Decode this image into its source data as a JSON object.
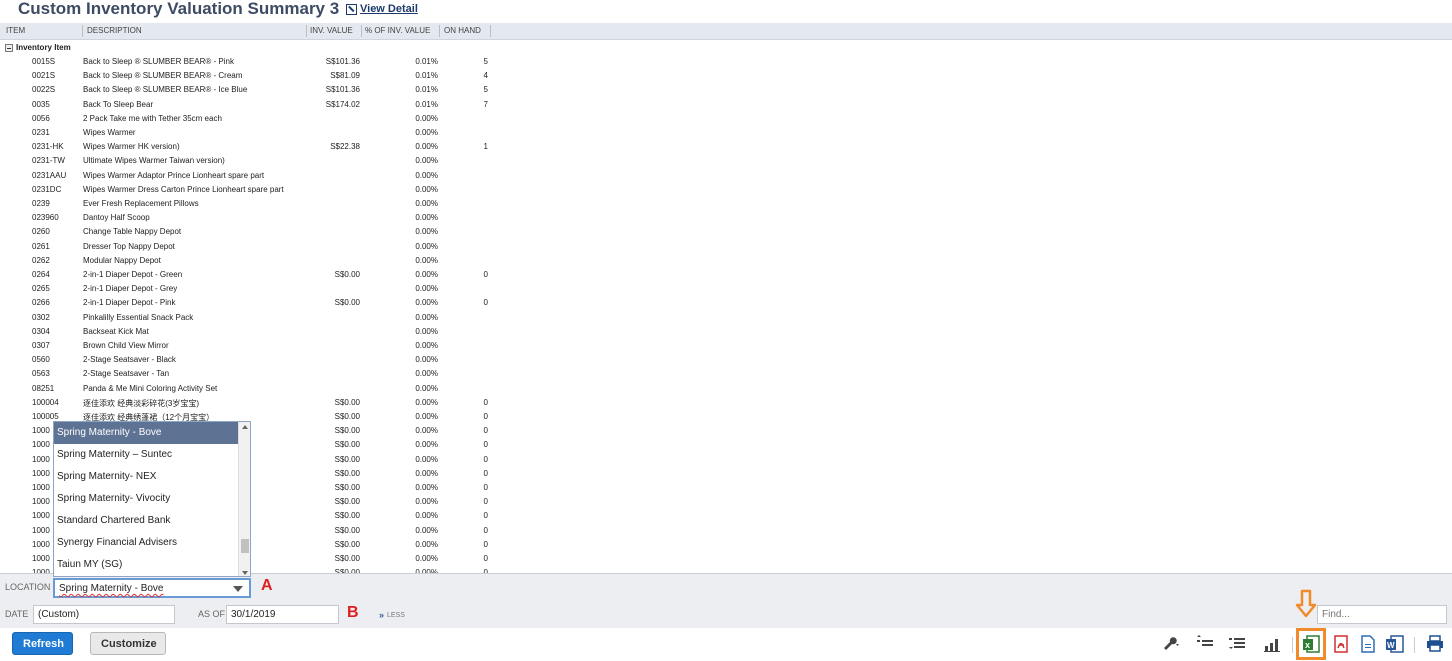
{
  "header": {
    "title": "Custom Inventory Valuation Summary 3",
    "view_detail": "View Detail"
  },
  "columns": {
    "item": "ITEM",
    "description": "DESCRIPTION",
    "inv_value": "INV. VALUE",
    "pct": "% OF INV. VALUE",
    "on_hand": "ON HAND"
  },
  "group": {
    "label": "Inventory Item"
  },
  "rows": [
    {
      "item": "0015S",
      "desc": "Back to Sleep ® SLUMBER BEAR® - Pink",
      "val": "S$101.36",
      "pct": "0.01%",
      "hand": "5"
    },
    {
      "item": "0021S",
      "desc": "Back to Sleep ® SLUMBER BEAR® - Cream",
      "val": "S$81.09",
      "pct": "0.01%",
      "hand": "4"
    },
    {
      "item": "0022S",
      "desc": "Back to Sleep ® SLUMBER BEAR® - Ice Blue",
      "val": "S$101.36",
      "pct": "0.01%",
      "hand": "5"
    },
    {
      "item": "0035",
      "desc": "Back To Sleep Bear",
      "val": "S$174.02",
      "pct": "0.01%",
      "hand": "7"
    },
    {
      "item": "0056",
      "desc": "2 Pack Take me with Tether 35cm each",
      "val": "",
      "pct": "0.00%",
      "hand": ""
    },
    {
      "item": "0231",
      "desc": "Wipes Warmer",
      "val": "",
      "pct": "0.00%",
      "hand": ""
    },
    {
      "item": "0231-HK",
      "desc": "Wipes Warmer HK version)",
      "val": "S$22.38",
      "pct": "0.00%",
      "hand": "1"
    },
    {
      "item": "0231-TW",
      "desc": "Ultimate Wipes Warmer Taiwan version)",
      "val": "",
      "pct": "0.00%",
      "hand": ""
    },
    {
      "item": "0231AAU",
      "desc": "Wipes Warmer Adaptor Prince Lionheart spare part",
      "val": "",
      "pct": "0.00%",
      "hand": ""
    },
    {
      "item": "0231DC",
      "desc": "Wipes Warmer Dress Carton Prince Lionheart spare part",
      "val": "",
      "pct": "0.00%",
      "hand": ""
    },
    {
      "item": "0239",
      "desc": "Ever Fresh Replacement Pillows",
      "val": "",
      "pct": "0.00%",
      "hand": ""
    },
    {
      "item": "023960",
      "desc": "Dantoy Half Scoop",
      "val": "",
      "pct": "0.00%",
      "hand": ""
    },
    {
      "item": "0260",
      "desc": "Change Table Nappy Depot",
      "val": "",
      "pct": "0.00%",
      "hand": ""
    },
    {
      "item": "0261",
      "desc": "Dresser Top Nappy Depot",
      "val": "",
      "pct": "0.00%",
      "hand": ""
    },
    {
      "item": "0262",
      "desc": "Modular Nappy Depot",
      "val": "",
      "pct": "0.00%",
      "hand": ""
    },
    {
      "item": "0264",
      "desc": "2-in-1 Diaper Depot - Green",
      "val": "S$0.00",
      "pct": "0.00%",
      "hand": "0"
    },
    {
      "item": "0265",
      "desc": "2-in-1 Diaper Depot - Grey",
      "val": "",
      "pct": "0.00%",
      "hand": ""
    },
    {
      "item": "0266",
      "desc": "2-in-1 Diaper Depot - Pink",
      "val": "S$0.00",
      "pct": "0.00%",
      "hand": "0"
    },
    {
      "item": "0302",
      "desc": "Pinkalilly Essential Snack Pack",
      "val": "",
      "pct": "0.00%",
      "hand": ""
    },
    {
      "item": "0304",
      "desc": "Backseat Kick Mat",
      "val": "",
      "pct": "0.00%",
      "hand": ""
    },
    {
      "item": "0307",
      "desc": "Brown Child View Mirror",
      "val": "",
      "pct": "0.00%",
      "hand": ""
    },
    {
      "item": "0560",
      "desc": "2-Stage Seatsaver - Black",
      "val": "",
      "pct": "0.00%",
      "hand": ""
    },
    {
      "item": "0563",
      "desc": "2-Stage Seatsaver - Tan",
      "val": "",
      "pct": "0.00%",
      "hand": ""
    },
    {
      "item": "08251",
      "desc": "Panda & Me Mini Coloring Activity Set",
      "val": "",
      "pct": "0.00%",
      "hand": ""
    },
    {
      "item": "100004",
      "desc": "逐佳添欢 经典淡彩碎花(3岁宝宝)",
      "val": "S$0.00",
      "pct": "0.00%",
      "hand": "0"
    },
    {
      "item": "100005",
      "desc": "逐佳添欢 经典绣蓬裙（12个月宝宝）",
      "val": "S$0.00",
      "pct": "0.00%",
      "hand": "0"
    },
    {
      "item": "1000",
      "desc": "",
      "val": "S$0.00",
      "pct": "0.00%",
      "hand": "0"
    },
    {
      "item": "1000",
      "desc": "",
      "val": "S$0.00",
      "pct": "0.00%",
      "hand": "0"
    },
    {
      "item": "1000",
      "desc": "",
      "val": "S$0.00",
      "pct": "0.00%",
      "hand": "0"
    },
    {
      "item": "1000",
      "desc": "",
      "val": "S$0.00",
      "pct": "0.00%",
      "hand": "0"
    },
    {
      "item": "1000",
      "desc": "",
      "val": "S$0.00",
      "pct": "0.00%",
      "hand": "0"
    },
    {
      "item": "1000",
      "desc": "",
      "val": "S$0.00",
      "pct": "0.00%",
      "hand": "0"
    },
    {
      "item": "1000",
      "desc": "",
      "val": "S$0.00",
      "pct": "0.00%",
      "hand": "0"
    },
    {
      "item": "1000",
      "desc": "",
      "val": "S$0.00",
      "pct": "0.00%",
      "hand": "0"
    },
    {
      "item": "1000",
      "desc": "",
      "val": "S$0.00",
      "pct": "0.00%",
      "hand": "0"
    },
    {
      "item": "1000",
      "desc": "",
      "val": "S$0.00",
      "pct": "0.00%",
      "hand": "0"
    },
    {
      "item": "1000",
      "desc": "",
      "val": "S$0.00",
      "pct": "0.00%",
      "hand": "0"
    },
    {
      "item": "1000",
      "desc": "",
      "val": "S$0.00",
      "pct": "0.00%",
      "hand": "0"
    }
  ],
  "dropdown": {
    "options": [
      "Spring Maternity - Bove",
      "Spring Maternity – Suntec",
      "Spring Maternity- NEX",
      "Spring Maternity- Vivocity",
      "Standard Chartered Bank",
      "Synergy Financial Advisers",
      "Taiun MY (SG)"
    ],
    "selected": "Spring Maternity - Bove"
  },
  "filters": {
    "location_label": "LOCATION",
    "location_value": "Spring Maternity - Bove",
    "date_label": "DATE",
    "date_value": "(Custom)",
    "asof_label": "AS OF",
    "asof_value": "30/1/2019",
    "less": "LESS",
    "find_placeholder": "Find..."
  },
  "annotations": {
    "a": "A",
    "b": "B"
  },
  "buttons": {
    "refresh": "Refresh",
    "customize": "Customize"
  },
  "toolbar": {
    "icons": [
      "wrench-icon",
      "collapse-all-icon",
      "expand-all-icon",
      "chart-icon",
      "excel-export-icon",
      "pdf-export-icon",
      "csv-export-icon",
      "word-export-icon",
      "print-icon"
    ],
    "highlight_color": "#f08a2a"
  }
}
